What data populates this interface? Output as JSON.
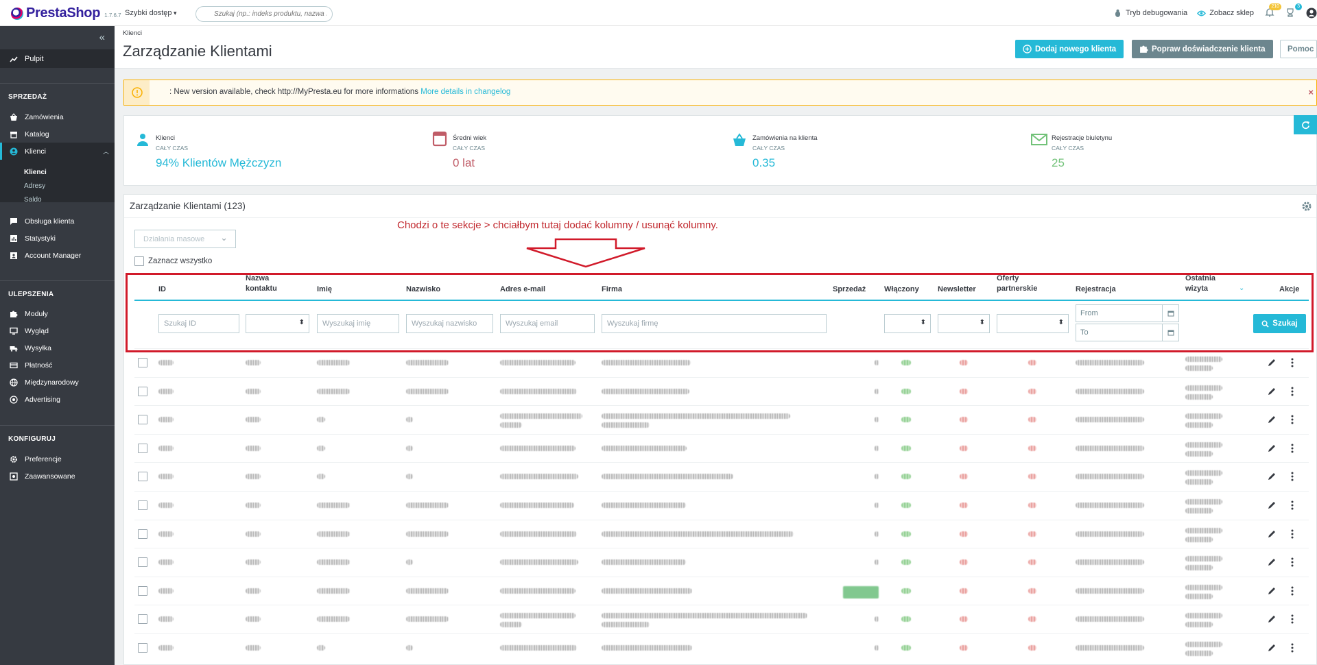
{
  "topbar": {
    "logo_text": "PrestaShop",
    "version": "1.7.6.7",
    "quick_access": "Szybki dostęp",
    "search_placeholder": "Szukaj (np.: indeks produktu, nazwa klie",
    "debug_mode": "Tryb debugowania",
    "view_shop": "Zobacz sklep",
    "notif_badge": "210",
    "orders_badge": "3"
  },
  "sidebar": {
    "dashboard": "Pulpit",
    "sections": [
      {
        "title": "SPRZEDAŻ",
        "items": [
          "Zamówienia",
          "Katalog",
          "Klienci"
        ]
      },
      {
        "title": "ULEPSZENIA",
        "items": [
          "Moduły",
          "Wygląd",
          "Wysyłka",
          "Płatność",
          "Międzynarodowy",
          "Advertising"
        ]
      },
      {
        "title": "KONFIGURUJ",
        "items": [
          "Preferencje",
          "Zaawansowane"
        ]
      }
    ],
    "customers_sub": [
      "Klienci",
      "Adresy",
      "Saldo"
    ],
    "extra_items": [
      "Obsługa klienta",
      "Statystyki",
      "Account Manager"
    ]
  },
  "header": {
    "breadcrumb": "Klienci",
    "title": "Zarządzanie Klientami",
    "add_button": "Dodaj nowego klienta",
    "improve_button": "Popraw doświadczenie klienta",
    "help_button": "Pomoc"
  },
  "alert": {
    "text": ": New version available, check http://MyPresta.eu for more informations ",
    "link": "More details in changelog",
    "close": "×"
  },
  "kpis": [
    {
      "label": "Klienci",
      "sub": "CAŁY CZAS",
      "value": "94% Klientów Mężczyzn",
      "color": "#25b9d7"
    },
    {
      "label": "Średni wiek",
      "sub": "CAŁY CZAS",
      "value": "0 lat",
      "color": "#c05c67"
    },
    {
      "label": "Zamówienia na klienta",
      "sub": "CAŁY CZAS",
      "value": "0.35",
      "color": "#25b9d7"
    },
    {
      "label": "Rejestracje biuletynu",
      "sub": "CAŁY CZAS",
      "value": "25",
      "color": "#72c279"
    }
  ],
  "panel": {
    "title": "Zarządzanie Klientami (123)",
    "bulk_actions": "Działania masowe",
    "select_all": "Zaznacz wszystko"
  },
  "annotation": "Chodzi o te sekcje > chciałbym tutaj dodać kolumny / usunąć kolumny.",
  "table": {
    "columns": [
      "ID",
      "Nazwa\nkontaktu",
      "Imię",
      "Nazwisko",
      "Adres e-mail",
      "Firma",
      "Sprzedaż",
      "Włączony",
      "Newsletter",
      "Oferty\npartnerskie",
      "Rejestracja",
      "Ostatnia\nwizyta",
      "Akcje"
    ],
    "filters": {
      "id": "Szukaj ID",
      "firstname": "Wyszukaj imię",
      "lastname": "Wyszukaj nazwisko",
      "email": "Wyszukaj email",
      "company": "Wyszukaj firmę",
      "date_from": "From",
      "date_to": "To",
      "search_button": "Szukaj"
    },
    "row_count_visible": 11
  },
  "colors": {
    "accent": "#25b9d7",
    "sidebar": "#363a41",
    "annotation_red": "#d11a2a"
  }
}
